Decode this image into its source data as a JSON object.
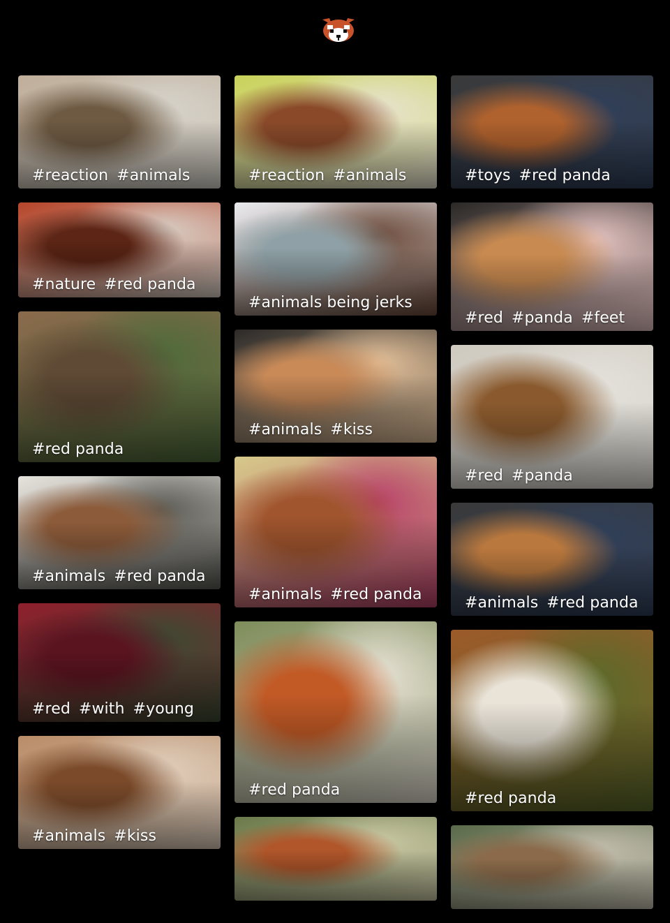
{
  "header": {
    "logo_icon": "red-panda-logo-icon"
  },
  "accent_color": "#c8532a",
  "columns": [
    {
      "tiles": [
        {
          "tags": [
            "reaction",
            "animals"
          ],
          "h": 162,
          "bg": [
            "#bfae9a",
            "#6e5a43",
            "#d7d4cc"
          ]
        },
        {
          "tags": [
            "nature",
            "red panda"
          ],
          "h": 136,
          "bg": [
            "#b5452a",
            "#5c2515",
            "#d9d0c7"
          ]
        },
        {
          "tags": [
            "red panda"
          ],
          "h": 216,
          "bg": [
            "#8a6a4c",
            "#5f4a35",
            "#4e6b3a"
          ]
        },
        {
          "tags": [
            "animals",
            "red panda"
          ],
          "h": 162,
          "bg": [
            "#e6e3dd",
            "#8c5b3a",
            "#5b5b55"
          ]
        },
        {
          "tags": [
            "red",
            "with",
            "young"
          ],
          "h": 170,
          "bg": [
            "#8e1f2c",
            "#5a1420",
            "#3c4a33"
          ]
        },
        {
          "tags": [
            "animals",
            "kiss"
          ],
          "h": 162,
          "bg": [
            "#b98c68",
            "#7a4a2a",
            "#e0cfbd"
          ]
        }
      ]
    },
    {
      "tiles": [
        {
          "tags": [
            "reaction",
            "animals"
          ],
          "h": 162,
          "bg": [
            "#c9d25a",
            "#8a4a2a",
            "#e8e3d0"
          ]
        },
        {
          "tags": [
            "animals being jerks"
          ],
          "h": 162,
          "bg": [
            "#e9eaee",
            "#8fa1a6",
            "#6b4a3a"
          ]
        },
        {
          "tags": [
            "animals",
            "kiss"
          ],
          "h": 162,
          "bg": [
            "#2c2a28",
            "#c98a58",
            "#e6c39c"
          ]
        },
        {
          "tags": [
            "animals",
            "red panda"
          ],
          "h": 216,
          "bg": [
            "#d6c98a",
            "#a0552e",
            "#b8416a"
          ]
        },
        {
          "tags": [
            "red panda"
          ],
          "h": 260,
          "bg": [
            "#7e8c5a",
            "#c25a26",
            "#e8e3d6"
          ]
        },
        {
          "tags": [],
          "h": 120,
          "bg": [
            "#6b7a4a",
            "#b0562a",
            "#cbc9a6"
          ]
        }
      ]
    },
    {
      "tiles": [
        {
          "tags": [
            "toys",
            "red panda"
          ],
          "h": 162,
          "bg": [
            "#3a3a3a",
            "#b0622e",
            "#2f3f5a"
          ]
        },
        {
          "tags": [
            "red",
            "panda",
            "feet"
          ],
          "h": 184,
          "bg": [
            "#2a2826",
            "#c88a50",
            "#e8c6c4"
          ]
        },
        {
          "tags": [
            "red",
            "panda"
          ],
          "h": 206,
          "bg": [
            "#cfcac0",
            "#8a5a2e",
            "#e4e2dc"
          ]
        },
        {
          "tags": [
            "animals",
            "red panda"
          ],
          "h": 162,
          "bg": [
            "#3a3a3a",
            "#b9783e",
            "#2f3f5a"
          ]
        },
        {
          "tags": [
            "red panda"
          ],
          "h": 260,
          "bg": [
            "#9c5a2a",
            "#e9e3d8",
            "#5a6a2a"
          ]
        },
        {
          "tags": [],
          "h": 120,
          "bg": [
            "#5a6a4a",
            "#8a6a4a",
            "#c6c0b0"
          ]
        }
      ]
    }
  ]
}
